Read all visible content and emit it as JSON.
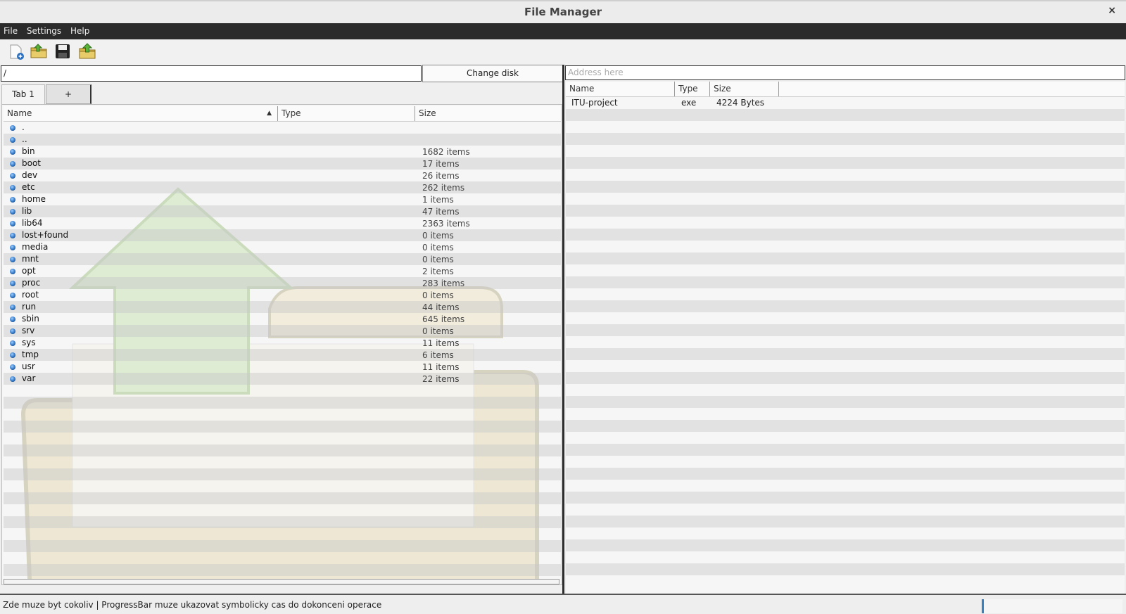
{
  "window": {
    "title": "File Manager",
    "close_glyph": "×"
  },
  "menu": [
    "File",
    "Settings",
    "Help"
  ],
  "toolbar": [
    {
      "icon": "new-file-icon"
    },
    {
      "icon": "open-folder-icon"
    },
    {
      "icon": "save-icon"
    },
    {
      "icon": "go-up-folder-icon"
    }
  ],
  "left": {
    "path": "/",
    "change_disk": "Change disk",
    "tabs": [
      "Tab 1",
      "+"
    ],
    "columns": [
      "Name",
      "Type",
      "Size"
    ],
    "rows": [
      {
        "name": ".",
        "size": ""
      },
      {
        "name": "..",
        "size": ""
      },
      {
        "name": "bin",
        "size": "1682 items"
      },
      {
        "name": "boot",
        "size": "17 items"
      },
      {
        "name": "dev",
        "size": "26 items"
      },
      {
        "name": "etc",
        "size": "262 items"
      },
      {
        "name": "home",
        "size": "1 items"
      },
      {
        "name": "lib",
        "size": "47 items"
      },
      {
        "name": "lib64",
        "size": "2363 items"
      },
      {
        "name": "lost+found",
        "size": "0 items"
      },
      {
        "name": "media",
        "size": "0 items"
      },
      {
        "name": "mnt",
        "size": "0 items"
      },
      {
        "name": "opt",
        "size": "2 items"
      },
      {
        "name": "proc",
        "size": "283 items"
      },
      {
        "name": "root",
        "size": "0 items"
      },
      {
        "name": "run",
        "size": "44 items"
      },
      {
        "name": "sbin",
        "size": "645 items"
      },
      {
        "name": "srv",
        "size": "0 items"
      },
      {
        "name": "sys",
        "size": "11 items"
      },
      {
        "name": "tmp",
        "size": "6 items"
      },
      {
        "name": "usr",
        "size": "11 items"
      },
      {
        "name": "var",
        "size": "22 items"
      }
    ]
  },
  "right": {
    "address_placeholder": "Address here",
    "columns": [
      "Name",
      "Type",
      "Size"
    ],
    "rows": [
      {
        "name": "ITU-project",
        "type": "exe",
        "size": "4224 Bytes"
      }
    ]
  },
  "status": {
    "text": "Zde muze byt cokoliv | ProgressBar muze ukazovat symbolicky cas do dokonceni operace"
  },
  "colors": {
    "menubar": "#2b2b2b",
    "progress_accent": "#3a7fbf"
  }
}
